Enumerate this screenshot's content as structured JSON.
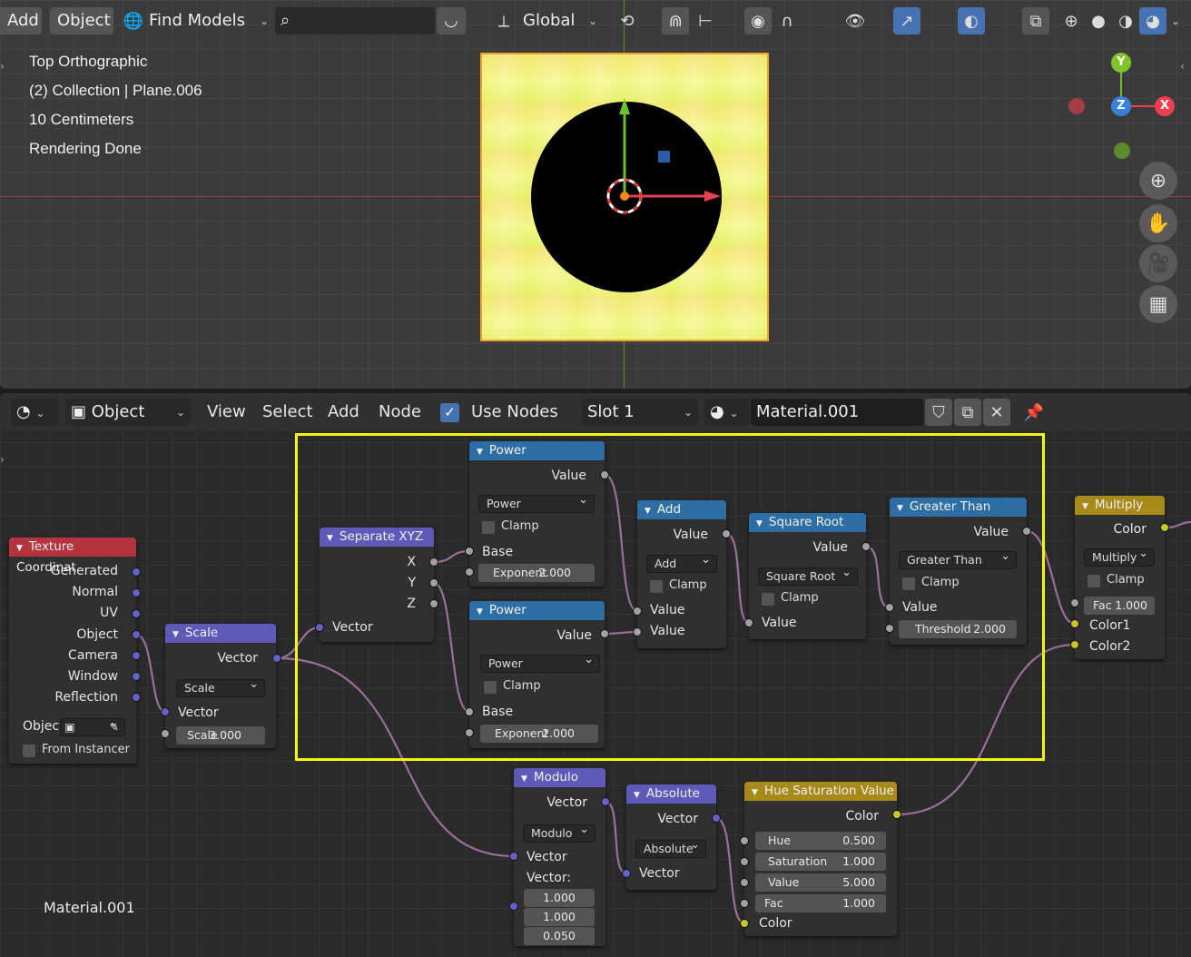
{
  "viewport": {
    "header": {
      "add": "Add",
      "object": "Object",
      "find_models": "Find Models",
      "search_placeholder": "",
      "orientation": "Global"
    },
    "overlay": {
      "view_name": "Top Orthographic",
      "collection": "(2) Collection | Plane.006",
      "scale": "10 Centimeters",
      "status": "Rendering Done"
    },
    "gizmo": {
      "x": "X",
      "y": "Y",
      "z": "Z"
    }
  },
  "node_editor": {
    "header": {
      "mode": "Object",
      "menus": [
        "View",
        "Select",
        "Add",
        "Node"
      ],
      "use_nodes_label": "Use Nodes",
      "use_nodes": true,
      "slot": "Slot 1",
      "material": "Material.001"
    },
    "material_label": "Material.001",
    "nodes": {
      "texcoord": {
        "title": "Texture Coordinat",
        "outputs": [
          "Generated",
          "Normal",
          "UV",
          "Object",
          "Camera",
          "Window",
          "Reflection"
        ],
        "object_label": "Object",
        "from_instancer": "From Instancer"
      },
      "scale": {
        "title": "Scale",
        "out": "Vector",
        "op": "Scale",
        "in": "Vector",
        "field_label": "Scale",
        "field_value": "3.000"
      },
      "sepxyz": {
        "title": "Separate XYZ",
        "outputs": [
          "X",
          "Y",
          "Z"
        ],
        "in": "Vector"
      },
      "power1": {
        "title": "Power",
        "out": "Value",
        "op": "Power",
        "clamp": "Clamp",
        "base": "Base",
        "exp_label": "Exponent",
        "exp_value": "2.000"
      },
      "power2": {
        "title": "Power",
        "out": "Value",
        "op": "Power",
        "clamp": "Clamp",
        "base": "Base",
        "exp_label": "Exponent",
        "exp_value": "2.000"
      },
      "add": {
        "title": "Add",
        "out": "Value",
        "op": "Add",
        "clamp": "Clamp",
        "in1": "Value",
        "in2": "Value"
      },
      "sqrt": {
        "title": "Square Root",
        "out": "Value",
        "op": "Square Root",
        "clamp": "Clamp",
        "in": "Value"
      },
      "gt": {
        "title": "Greater Than",
        "out": "Value",
        "op": "Greater Than",
        "clamp": "Clamp",
        "in": "Value",
        "thr_label": "Threshold",
        "thr_value": "2.000"
      },
      "multiply": {
        "title": "Multiply",
        "out": "Color",
        "op": "Multiply",
        "clamp": "Clamp",
        "fac_label": "Fac",
        "fac_value": "1.000",
        "in1": "Color1",
        "in2": "Color2"
      },
      "modulo": {
        "title": "Modulo",
        "out": "Vector",
        "op": "Modulo",
        "in": "Vector",
        "in2_label": "Vector:",
        "values": [
          "1.000",
          "1.000",
          "0.050"
        ]
      },
      "absolute": {
        "title": "Absolute",
        "out": "Vector",
        "op": "Absolute",
        "in": "Vector"
      },
      "hsv": {
        "title": "Hue Saturation Value",
        "out": "Color",
        "rows": [
          {
            "label": "Hue",
            "value": "0.500"
          },
          {
            "label": "Saturation",
            "value": "1.000"
          },
          {
            "label": "Value",
            "value": "5.000"
          },
          {
            "label": "Fac",
            "value": "1.000"
          }
        ],
        "in": "Color"
      }
    }
  }
}
